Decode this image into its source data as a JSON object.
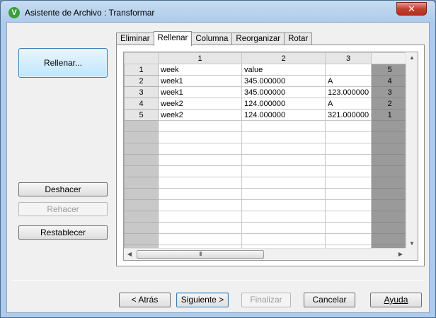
{
  "window": {
    "title": "Asistente de Archivo : Transformar",
    "app_icon": "V",
    "close_glyph": "✕"
  },
  "sidebar": {
    "rellenar_label": "Rellenar...",
    "deshacer_label": "Deshacer",
    "rehacer_label": "Rehacer",
    "restablecer_label": "Restablecer"
  },
  "tabs": [
    {
      "label": "Eliminar",
      "active": false
    },
    {
      "label": "Rellenar",
      "active": true
    },
    {
      "label": "Columna",
      "active": false
    },
    {
      "label": "Reorganizar",
      "active": false
    },
    {
      "label": "Rotar",
      "active": false
    }
  ],
  "grid": {
    "columns": [
      "1",
      "2",
      "3"
    ],
    "rows": [
      {
        "num": "1",
        "c1": "week",
        "c2": "value",
        "c3": "",
        "extra": "5"
      },
      {
        "num": "2",
        "c1": "week1",
        "c2": "345.000000",
        "c3": "A",
        "extra": "4"
      },
      {
        "num": "3",
        "c1": "week1",
        "c2": "345.000000",
        "c3": "123.000000",
        "extra": "3"
      },
      {
        "num": "4",
        "c1": "week2",
        "c2": "124.000000",
        "c3": "A",
        "extra": "2"
      },
      {
        "num": "5",
        "c1": "week2",
        "c2": "124.000000",
        "c3": "321.000000",
        "extra": "1"
      }
    ],
    "empty_rows": 12,
    "hscroll_grip": "III"
  },
  "footer": {
    "atras_label": "< Atrás",
    "siguiente_label": "Siguiente >",
    "finalizar_label": "Finalizar",
    "cancelar_label": "Cancelar",
    "ayuda_label": "Ayuda"
  },
  "colors": {
    "title_bar": "#aecbeb",
    "close": "#c3412c",
    "accent": "#3c7fb1"
  }
}
